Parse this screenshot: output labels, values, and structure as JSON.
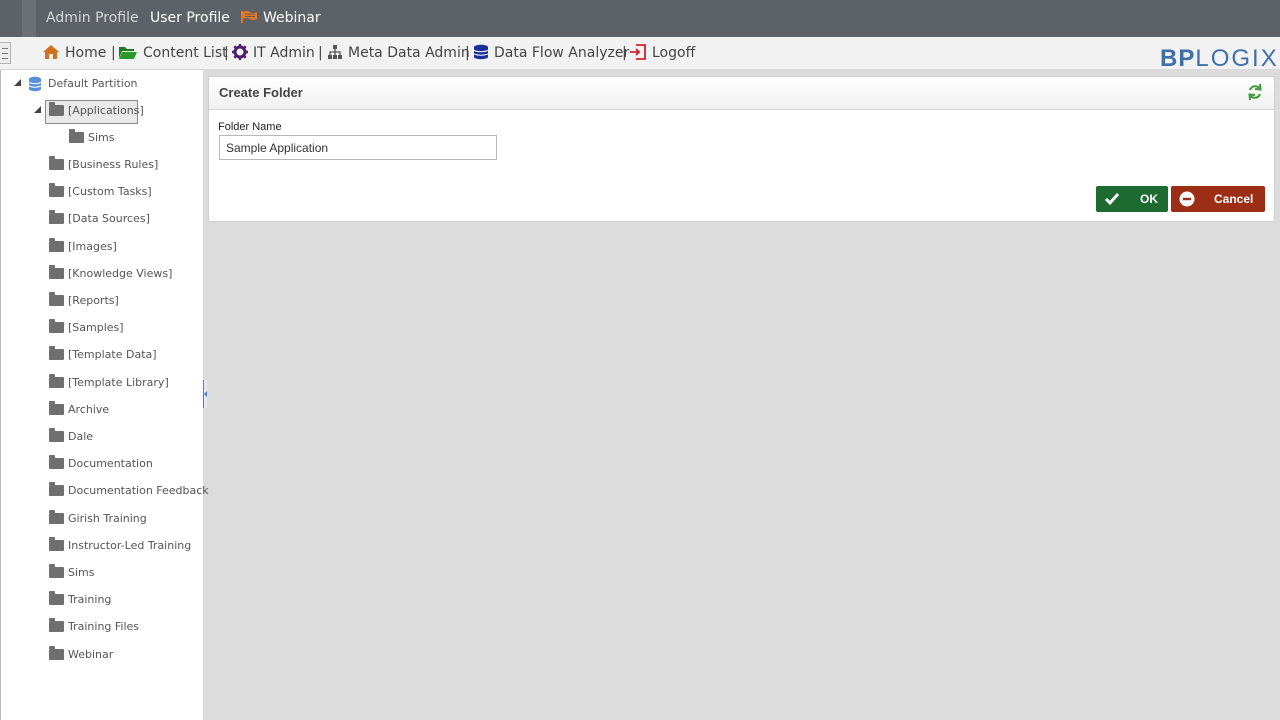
{
  "top_tabs": {
    "admin_profile": "Admin Profile",
    "user_profile": "User Profile",
    "webinar": "Webinar"
  },
  "nav": {
    "home": "Home",
    "content_list": "Content List",
    "it_admin": "IT Admin",
    "meta_data_admin": "Meta Data Admin",
    "data_flow_analyzer": "Data Flow Analyzer",
    "logoff": "Logoff",
    "separator": "|"
  },
  "logo": {
    "part1": "BP",
    "part2": "LOGIX"
  },
  "tree": {
    "root": "Default Partition",
    "selected": "[Applications]",
    "child": "Sims",
    "folders": [
      "[Business Rules]",
      "[Custom Tasks]",
      "[Data Sources]",
      "[Images]",
      "[Knowledge Views]",
      "[Reports]",
      "[Samples]",
      "[Template Data]",
      "[Template Library]",
      "Archive",
      "Dale",
      "Documentation",
      "Documentation Feedback",
      "Girish Training",
      "Instructor-Led Training",
      "Sims",
      "Training",
      "Training Files",
      "Webinar"
    ]
  },
  "panel": {
    "title": "Create Folder",
    "field_label": "Folder Name",
    "field_value": "Sample Application",
    "ok_label": "OK",
    "cancel_label": "Cancel"
  },
  "colors": {
    "topbar": "#5d6168",
    "ok": "#1d6b31",
    "cancel": "#9b2e14",
    "logo": "#3f6fa9",
    "workspace": "#dcdcdc"
  },
  "icons": {
    "home": "home-icon",
    "content_list": "folder-open-icon",
    "it_admin": "gear-icon",
    "meta_data_admin": "sitemap-icon",
    "data_flow_analyzer": "database-icon",
    "logoff": "logout-icon",
    "refresh": "refresh-icon"
  }
}
